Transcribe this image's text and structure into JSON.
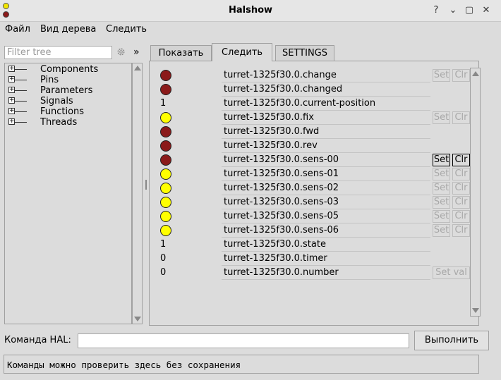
{
  "window": {
    "title": "Halshow",
    "controls": [
      "?",
      "⌄",
      "▢",
      "✕"
    ]
  },
  "menu": [
    "Файл",
    "Вид дерева",
    "Следить"
  ],
  "left": {
    "filter_placeholder": "Filter tree",
    "gear_icon": "gear-icon",
    "expand_label": "»",
    "tree": [
      "Components",
      "Pins",
      "Parameters",
      "Signals",
      "Functions",
      "Threads"
    ]
  },
  "tabs": [
    {
      "label": "Показать",
      "active": false
    },
    {
      "label": "Следить",
      "active": true
    },
    {
      "label": "SETTINGS",
      "active": false
    }
  ],
  "colors": {
    "led_on": "#ffff00",
    "led_off": "#8b1a1a"
  },
  "watch": [
    {
      "name": "turret-1325f30.0.change",
      "kind": "led",
      "state": "off",
      "set": "Set",
      "clr": "Clr",
      "buttons_enabled": false
    },
    {
      "name": "turret-1325f30.0.changed",
      "kind": "led",
      "state": "off"
    },
    {
      "name": "turret-1325f30.0.current-position",
      "kind": "value",
      "value": "1"
    },
    {
      "name": "turret-1325f30.0.fix",
      "kind": "led",
      "state": "on",
      "set": "Set",
      "clr": "Clr",
      "buttons_enabled": false
    },
    {
      "name": "turret-1325f30.0.fwd",
      "kind": "led",
      "state": "off"
    },
    {
      "name": "turret-1325f30.0.rev",
      "kind": "led",
      "state": "off"
    },
    {
      "name": "turret-1325f30.0.sens-00",
      "kind": "led",
      "state": "off",
      "set": "Set",
      "clr": "Clr",
      "buttons_enabled": true
    },
    {
      "name": "turret-1325f30.0.sens-01",
      "kind": "led",
      "state": "on",
      "set": "Set",
      "clr": "Clr",
      "buttons_enabled": false
    },
    {
      "name": "turret-1325f30.0.sens-02",
      "kind": "led",
      "state": "on",
      "set": "Set",
      "clr": "Clr",
      "buttons_enabled": false
    },
    {
      "name": "turret-1325f30.0.sens-03",
      "kind": "led",
      "state": "on",
      "set": "Set",
      "clr": "Clr",
      "buttons_enabled": false
    },
    {
      "name": "turret-1325f30.0.sens-05",
      "kind": "led",
      "state": "on",
      "set": "Set",
      "clr": "Clr",
      "buttons_enabled": false
    },
    {
      "name": "turret-1325f30.0.sens-06",
      "kind": "led",
      "state": "on",
      "set": "Set",
      "clr": "Clr",
      "buttons_enabled": false
    },
    {
      "name": "turret-1325f30.0.state",
      "kind": "value",
      "value": "1"
    },
    {
      "name": "turret-1325f30.0.timer",
      "kind": "value",
      "value": "0"
    },
    {
      "name": "turret-1325f30.0.number",
      "kind": "value",
      "value": "0",
      "setval": "Set val",
      "buttons_enabled": false
    }
  ],
  "command": {
    "label": "Команда HAL:",
    "value": "",
    "run_label": "Выполнить"
  },
  "status": "Команды можно проверить здесь без сохранения"
}
